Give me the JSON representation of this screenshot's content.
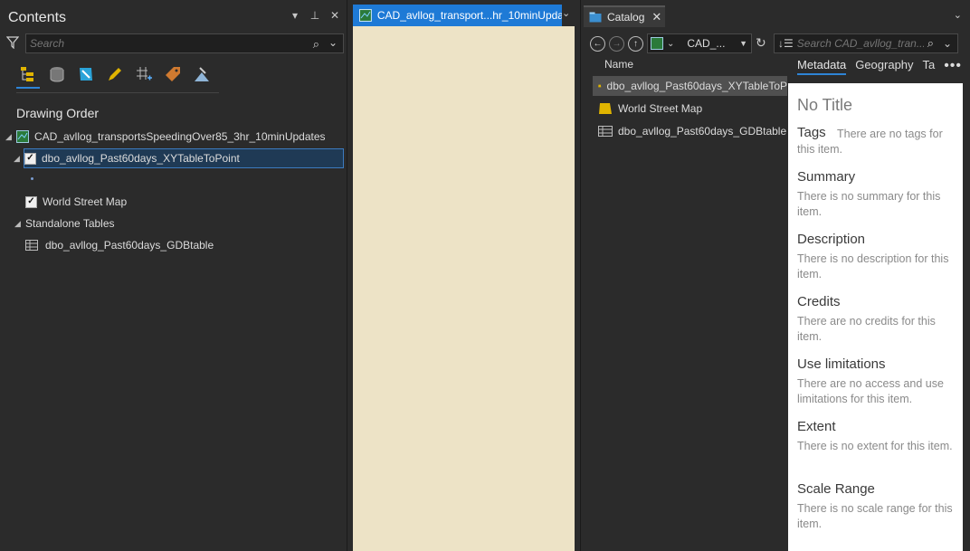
{
  "contents": {
    "title": "Contents",
    "header_icons": [
      "▾",
      "⊥",
      "✕"
    ],
    "search_placeholder": "Search",
    "section_title": "Drawing Order",
    "map_name": "CAD_avllog_transportsSpeedingOver85_3hr_10minUpdates",
    "layers": [
      {
        "label": "dbo_avllog_Past60days_XYTableToPoint",
        "checked": true
      },
      {
        "label": "World Street Map",
        "checked": true
      }
    ],
    "standalone_title": "Standalone Tables",
    "table_label": "dbo_avllog_Past60days_GDBtable"
  },
  "mapview": {
    "tab_label": "CAD_avllog_transport...hr_10minUpda"
  },
  "catalog": {
    "tab_label": "Catalog",
    "address": "CAD_...",
    "search_placeholder": "Search CAD_avllog_tran...",
    "column_name": "Name",
    "items": [
      {
        "label": "dbo_avllog_Past60days_XYTableToP",
        "selected": true
      },
      {
        "label": "World Street Map",
        "selected": false
      },
      {
        "label": "dbo_avllog_Past60days_GDBtable",
        "selected": false
      }
    ],
    "meta_tabs": [
      "Metadata",
      "Geography",
      "Ta"
    ],
    "metadata": {
      "title": "No Title",
      "tags_label": "Tags",
      "tags_text": "There are no tags for this item.",
      "summary_label": "Summary",
      "summary_text": "There is no summary for this item.",
      "description_label": "Description",
      "description_text": "There is no description for this item.",
      "credits_label": "Credits",
      "credits_text": "There are no credits for this item.",
      "use_label": "Use limitations",
      "use_text": "There are no access and use limitations for this item.",
      "extent_label": "Extent",
      "extent_text": "There is no extent for this item.",
      "scale_label": "Scale Range",
      "scale_text": "There is no scale range for this item."
    }
  }
}
